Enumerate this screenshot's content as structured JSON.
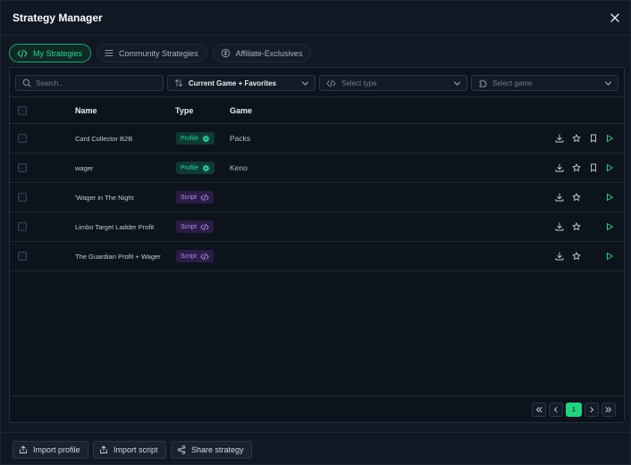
{
  "window": {
    "title": "Strategy Manager"
  },
  "tabs": [
    {
      "label": "My Strategies",
      "icon": "code-icon",
      "active": true
    },
    {
      "label": "Community Strategies",
      "icon": "list-icon",
      "active": false
    },
    {
      "label": "Affiliate-Exclusives",
      "icon": "coin-icon",
      "active": false
    }
  ],
  "filters": {
    "search_placeholder": "Search...",
    "sort_value": "Current Game + Favorites",
    "type_placeholder": "Select type",
    "game_placeholder": "Select game"
  },
  "table": {
    "headers": {
      "name": "Name",
      "type": "Type",
      "game": "Game"
    },
    "rows": [
      {
        "name": "Card Collector B2B",
        "type": "Profile",
        "game": "Packs",
        "bookmark": true
      },
      {
        "name": "wager",
        "type": "Profile",
        "game": "Keno",
        "bookmark": true
      },
      {
        "name": "'Wager in The Night",
        "type": "Script",
        "game": "",
        "bookmark": false
      },
      {
        "name": "Limbo Target Ladder Profit",
        "type": "Script",
        "game": "",
        "bookmark": false
      },
      {
        "name": "The Guardian Profit + Wager",
        "type": "Script",
        "game": "",
        "bookmark": false
      }
    ]
  },
  "pagination": {
    "current_page": "1"
  },
  "footer": {
    "import_profile": "Import profile",
    "import_script": "Import script",
    "share_strategy": "Share strategy"
  },
  "colors": {
    "accent_green": "#22d47f",
    "profile_badge": "#25d89a",
    "script_badge": "#b68cf5"
  }
}
